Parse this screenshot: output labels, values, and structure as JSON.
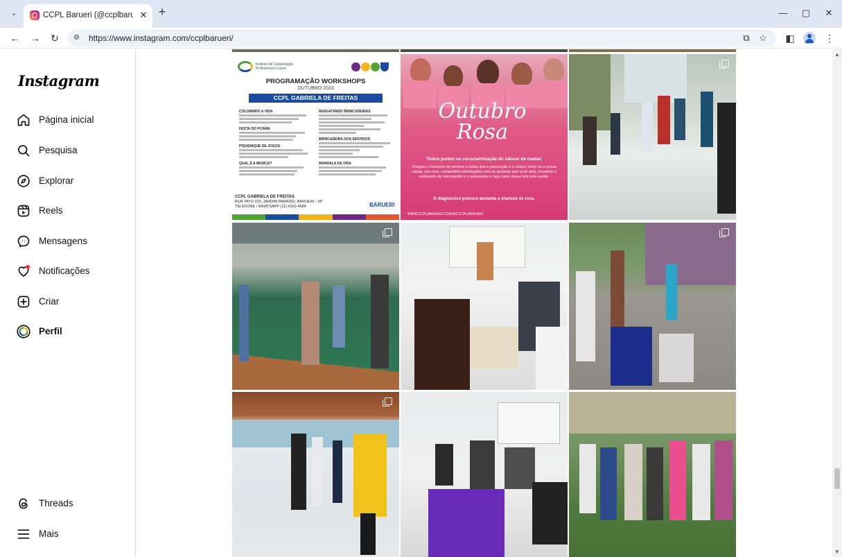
{
  "browser": {
    "tab_title": "CCPL Barueri (@ccplbarueri) • F",
    "url": "https://www.instagram.com/ccplbarueri/",
    "icons": {
      "tab_search": "chevron-down-icon",
      "new_tab": "plus-icon",
      "close_tab": "close-icon",
      "back": "arrow-left-icon",
      "forward": "arrow-right-icon",
      "reload": "reload-icon",
      "site_info": "tune-icon",
      "install": "install-app-icon",
      "bookmark": "star-icon",
      "side_panel": "side-panel-icon",
      "profile": "profile-icon",
      "menu": "kebab-menu-icon"
    }
  },
  "sidebar": {
    "logo": "Instagram",
    "items": [
      {
        "label": "Página inicial",
        "icon": "home-icon"
      },
      {
        "label": "Pesquisa",
        "icon": "search-icon"
      },
      {
        "label": "Explorar",
        "icon": "compass-icon"
      },
      {
        "label": "Reels",
        "icon": "reels-icon"
      },
      {
        "label": "Mensagens",
        "icon": "messenger-icon"
      },
      {
        "label": "Notificações",
        "icon": "heart-icon"
      },
      {
        "label": "Criar",
        "icon": "plus-square-icon"
      },
      {
        "label": "Perfil",
        "icon": "avatar-icon"
      }
    ],
    "bottom": [
      {
        "label": "Threads",
        "icon": "threads-icon"
      },
      {
        "label": "Mais",
        "icon": "menu-icon"
      }
    ]
  },
  "posts": {
    "flyer": {
      "institute": "Instituto de Capacitação Profissional e Lazer",
      "title": "PROGRAMAÇÃO WORKSHOPS",
      "subtitle": "OUTUBRO 2023",
      "banner": "CCPL GABRIELA DE FREITAS",
      "sections_left": [
        "COLORINDO A VIDA",
        "FESTA DO PIJAMA",
        "PIQUENIQUE DE JOGOS",
        "QUAL É A MÚSICA?"
      ],
      "sections_right": [
        "RESGATANDO BRINCADEIRAS",
        "BRINCADEIRA DOS SENTIDOS",
        "MANDALA DA VIDA"
      ],
      "footer_name": "CCPL GABRIELA DE FREITAS",
      "footer_addr": "RUA TAYO 310, JARDIM PARAÍSO, BARUERI - SP",
      "footer_phone": "TELEFONE / WHATSAPP (11) 4192-4684",
      "brand": "BARUERI"
    },
    "rosa": {
      "script": "Outubro Rosa",
      "tagline": "Todos juntos na conscientização do câncer de mama!",
      "body": "Chegou o momento de lembrar a todos que a prevenção é a chave! Junte-se a nossa causa, use rosa, compartilhe informações com as pessoas que você ama, incentive a realização da mamografia e o autoexame e faça parte dessa luta pela saúde.",
      "closing": "O diagnóstico precoce aumenta a chances de cura.",
      "footer": "WWW.CCPLBARUERI.COM.BR    CCPLBARUERI"
    }
  },
  "colors": {
    "accent_blue": "#1c4aa0",
    "rosa_pink": "#d63a74",
    "notification_red": "#ff3040"
  }
}
